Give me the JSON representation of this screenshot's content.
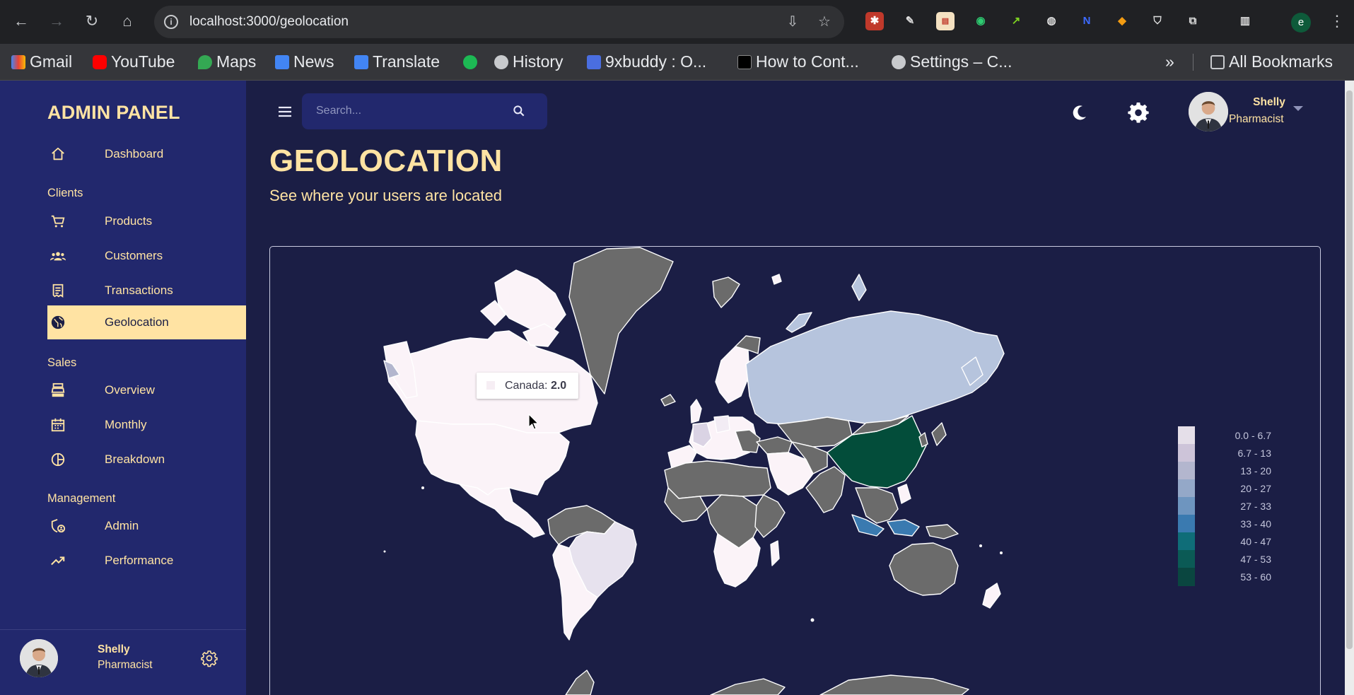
{
  "browser": {
    "url": "localhost:3000/geolocation",
    "profile_initial": "e",
    "bookmarks": [
      "Gmail",
      "YouTube",
      "Maps",
      "News",
      "Translate",
      "",
      "History",
      "9xbuddy : O...",
      "How to Cont...",
      "Settings – C..."
    ],
    "all_bookmarks": "All Bookmarks",
    "overflow": "»"
  },
  "sidebar": {
    "brand": "ADMIN PANEL",
    "items": [
      {
        "label": "Dashboard",
        "icon": "home-icon"
      },
      {
        "label": "Products",
        "icon": "cart-icon"
      },
      {
        "label": "Customers",
        "icon": "group-icon"
      },
      {
        "label": "Transactions",
        "icon": "receipt-icon"
      },
      {
        "label": "Geolocation",
        "icon": "globe-icon",
        "active": true
      },
      {
        "label": "Overview",
        "icon": "point-of-sale-icon"
      },
      {
        "label": "Monthly",
        "icon": "calendar-icon"
      },
      {
        "label": "Breakdown",
        "icon": "pie-chart-icon"
      },
      {
        "label": "Admin",
        "icon": "admin-icon"
      },
      {
        "label": "Performance",
        "icon": "trending-up-icon"
      }
    ],
    "sections": [
      "Clients",
      "Sales",
      "Management"
    ],
    "user": {
      "name": "Shelly",
      "role": "Pharmacist"
    }
  },
  "topbar": {
    "search_placeholder": "Search...",
    "user": {
      "name": "Shelly",
      "role": "Pharmacist"
    }
  },
  "page": {
    "title": "GEOLOCATION",
    "subtitle": "See where your users are located"
  },
  "map": {
    "tooltip_country": "Canada: ",
    "tooltip_value": "2.0",
    "legend": [
      "0.0 - 6.7",
      "6.7 - 13",
      "13 - 20",
      "20 - 27",
      "27 - 33",
      "33 - 40",
      "40 - 47",
      "47 - 53",
      "53 - 60"
    ],
    "legend_colors": [
      "#e5dfe9",
      "#cdc4d9",
      "#b3b6ce",
      "#94a8c8",
      "#6e95bf",
      "#3a7ab0",
      "#0f6d78",
      "#0b5a55",
      "#0a4640"
    ],
    "no_data_color": "#6b6b6b",
    "low_color": "#fbf3f8"
  }
}
